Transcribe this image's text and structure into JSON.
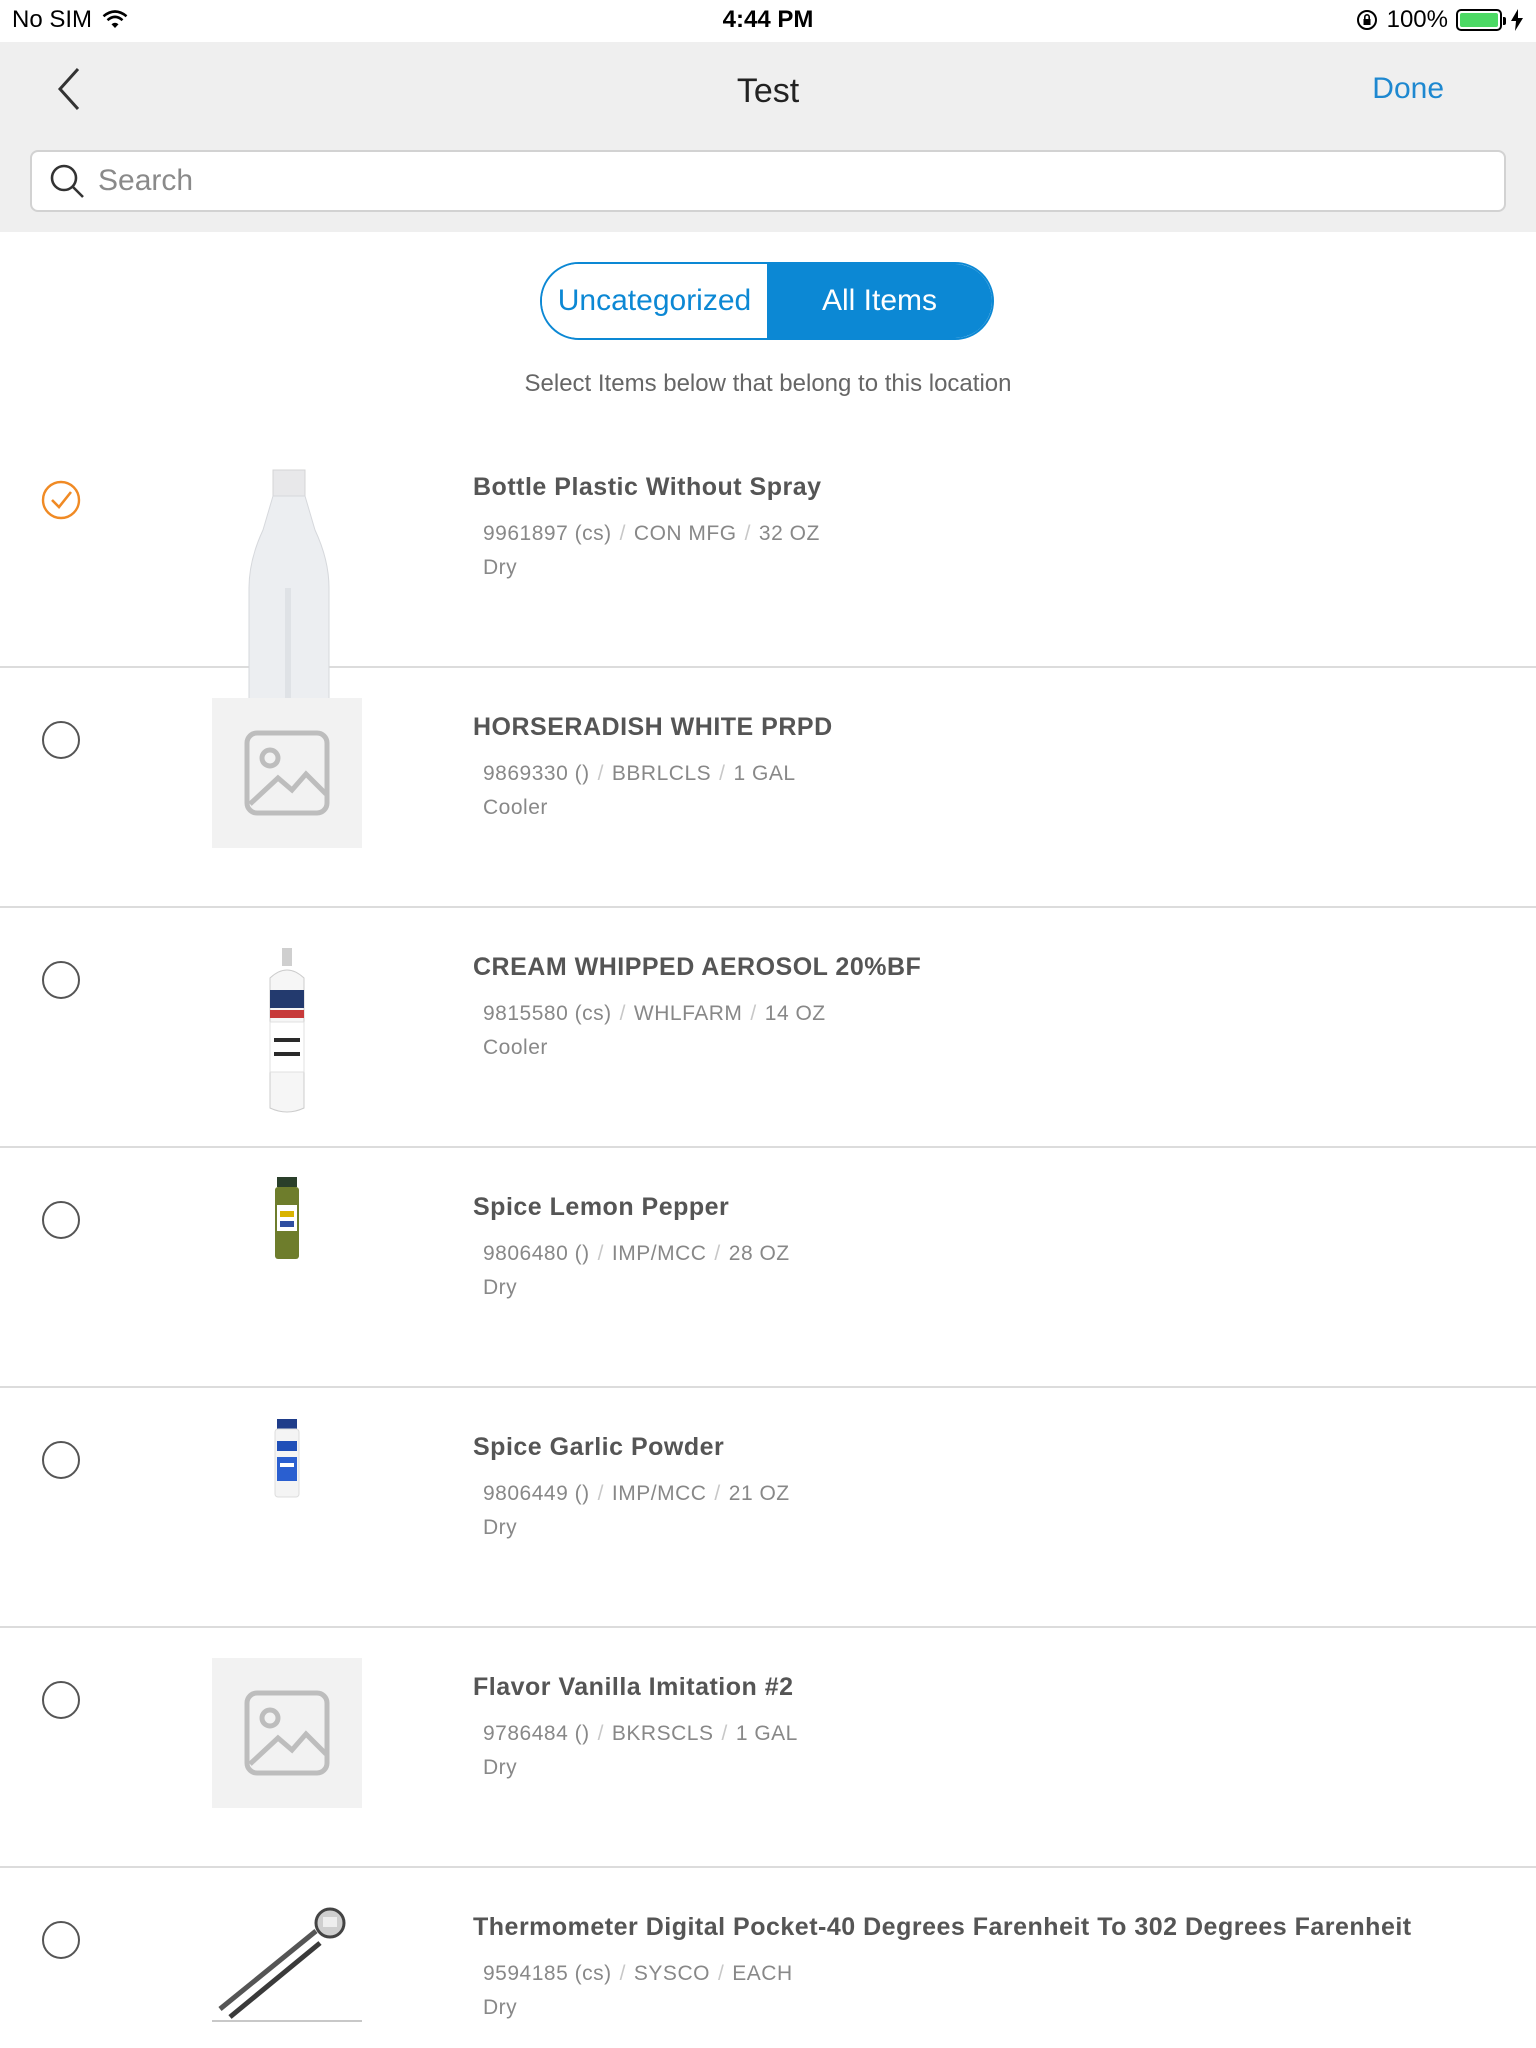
{
  "status_bar": {
    "carrier": "No SIM",
    "time": "4:44 PM",
    "battery": "100%",
    "battery_level": 1.0,
    "battery_color": "#4cd964"
  },
  "header": {
    "title": "Test",
    "back_icon": "chevron-left-icon",
    "done_label": "Done"
  },
  "search": {
    "placeholder": "Search",
    "value": ""
  },
  "segments": {
    "options": [
      "Uncategorized",
      "All Items"
    ],
    "selected": "All Items",
    "accent_color": "#0c88d4"
  },
  "instruction": "Select Items below that belong to this location",
  "items": [
    {
      "name": "Bottle Plastic Without Spray",
      "code": "9961897 (cs)",
      "brand": "CON MFG",
      "pack": "32 OZ",
      "location": "Dry",
      "selected": true,
      "image": "spray-bottle-image"
    },
    {
      "name": "HORSERADISH WHITE PRPD",
      "code": "9869330 ()",
      "brand": "BBRLCLS",
      "pack": "1 GAL",
      "location": "Cooler",
      "selected": false,
      "image": "image-placeholder-icon"
    },
    {
      "name": "CREAM WHIPPED AEROSOL 20%BF",
      "code": "9815580 (cs)",
      "brand": "WHLFARM",
      "pack": "14 OZ",
      "location": "Cooler",
      "selected": false,
      "image": "aerosol-can-image"
    },
    {
      "name": "Spice Lemon Pepper",
      "code": "9806480 ()",
      "brand": "IMP/MCC",
      "pack": "28 OZ",
      "location": "Dry",
      "selected": false,
      "image": "spice-jar-image"
    },
    {
      "name": "Spice Garlic Powder",
      "code": "9806449 ()",
      "brand": "IMP/MCC",
      "pack": "21 OZ",
      "location": "Dry",
      "selected": false,
      "image": "spice-jar-image"
    },
    {
      "name": "Flavor Vanilla Imitation #2",
      "code": "9786484 ()",
      "brand": "BKRSCLS",
      "pack": "1 GAL",
      "location": "Dry",
      "selected": false,
      "image": "image-placeholder-icon"
    },
    {
      "name": "Thermometer Digital Pocket-40 Degrees Farenheit To 302 Degrees Farenheit",
      "code": "9594185 (cs)",
      "brand": "SYSCO",
      "pack": "EACH",
      "location": "Dry",
      "selected": false,
      "image": "thermometer-image"
    }
  ],
  "colors": {
    "selected_check": "#f08a24",
    "unselected_circle": "#555555"
  }
}
